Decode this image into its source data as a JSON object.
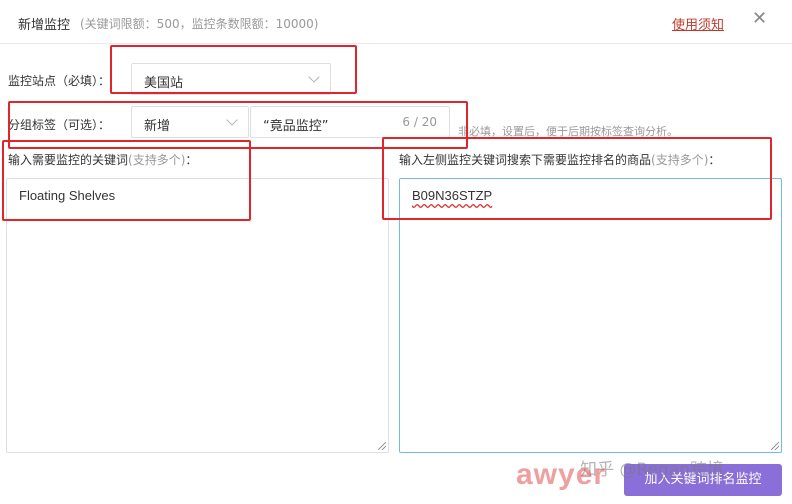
{
  "dialog": {
    "title": "新增监控",
    "limit_text": "(关键词限额：500，监控条数限额：10000)",
    "notice_link": "使用须知",
    "close_glyph": "✕"
  },
  "site": {
    "label": "监控站点（必填）：",
    "value": "美国站"
  },
  "group": {
    "label": "分组标签（可选）：",
    "mode_value": "新增",
    "tag_value": "“竟品监控”",
    "counter": "6 / 20",
    "hint": "非必填，设置后，便于后期按标签查询分析。"
  },
  "keywords": {
    "label": "输入需要监控的关键词",
    "label_note": "(支持多个)",
    "label_suffix": "：",
    "value": "Floating Shelves"
  },
  "products": {
    "label": "输入左侧监控关键词搜索下需要监控排名的商品",
    "label_note": "(支持多个)",
    "label_suffix": "：",
    "value": "B09N36STZP"
  },
  "footer": {
    "submit_label": "加入关键词排名监控"
  },
  "watermarks": {
    "zhihu": "知乎 @Regan跨境",
    "awyer": "awyer"
  },
  "colors": {
    "annotation_red": "#e1252b",
    "primary_button": "#8a6fd8",
    "link_red": "#c0392b"
  }
}
